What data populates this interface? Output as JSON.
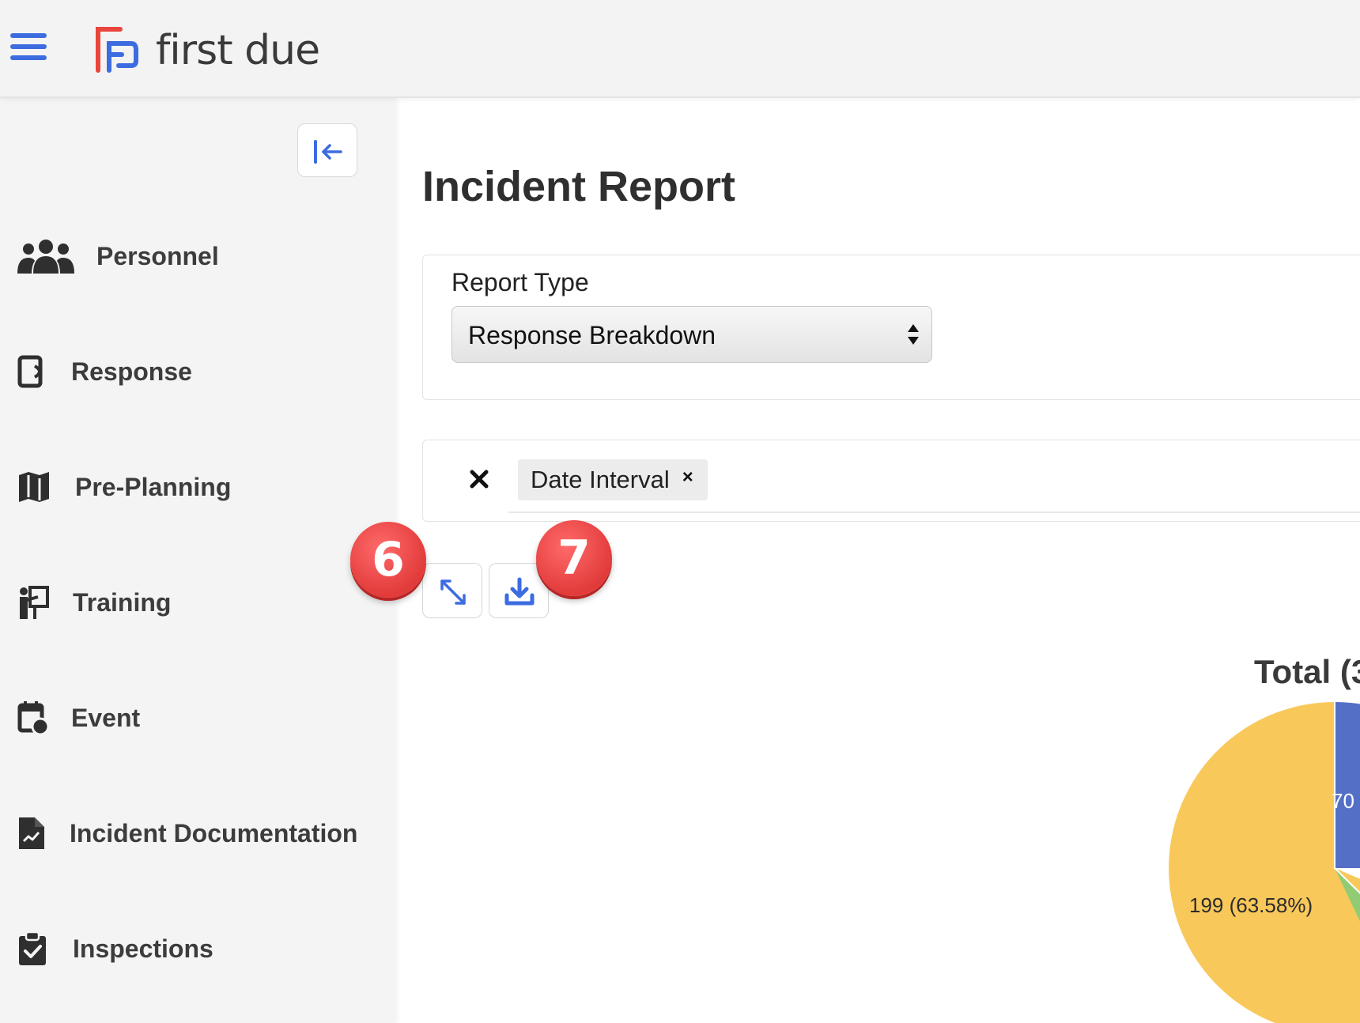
{
  "header": {
    "brand": "first due",
    "colors": {
      "accent": "#3d6be0",
      "logo_red": "#e8453c",
      "logo_blue": "#3d6be0"
    }
  },
  "sidebar": {
    "collapse_icon": "collapse-left-icon",
    "items": [
      {
        "label": "Personnel",
        "icon": "people-icon"
      },
      {
        "label": "Response",
        "icon": "tablet-icon"
      },
      {
        "label": "Pre-Planning",
        "icon": "map-icon"
      },
      {
        "label": "Training",
        "icon": "presentation-icon"
      },
      {
        "label": "Event",
        "icon": "calendar-icon"
      },
      {
        "label": "Incident Documentation",
        "icon": "document-chart-icon"
      },
      {
        "label": "Inspections",
        "icon": "clipboard-check-icon"
      }
    ]
  },
  "main": {
    "title": "Incident Report",
    "report_type": {
      "label": "Report Type",
      "selected": "Response Breakdown"
    },
    "filters": {
      "chips": [
        {
          "label": "Date Interval",
          "remove": "×"
        }
      ]
    },
    "toolbar": {
      "expand_icon": "expand-icon",
      "download_icon": "download-icon"
    },
    "annotations": [
      "6",
      "7"
    ]
  },
  "chart_data": {
    "type": "pie",
    "title": "Total (3",
    "slices": [
      {
        "value": 199,
        "label": "199 (63.58%)",
        "color": "#f9c85a"
      },
      {
        "value": 70,
        "label": "70",
        "color": "#5470c6"
      },
      {
        "label": "",
        "color": "#91cc75"
      }
    ]
  }
}
